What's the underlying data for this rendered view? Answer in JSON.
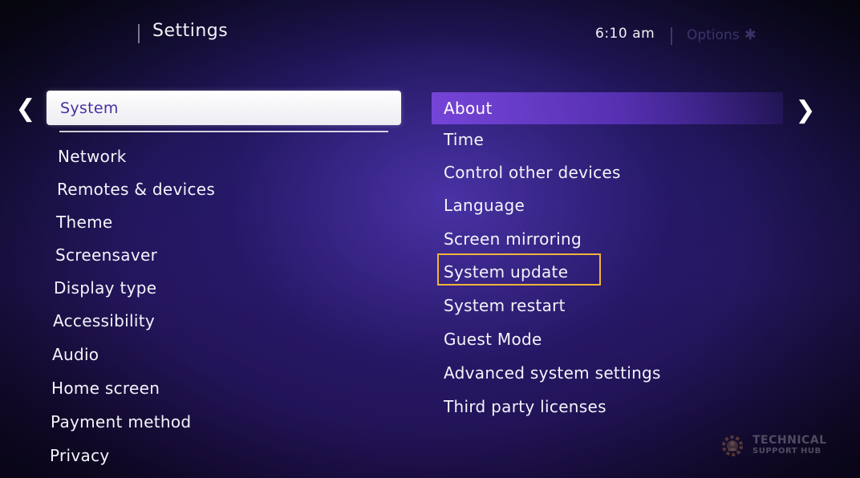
{
  "header": {
    "title": "Settings",
    "time": "6:10",
    "ampm": "am",
    "options_label": "Options",
    "options_icon_glyph": "✱"
  },
  "nav": {
    "left_arrow_glyph": "❮",
    "right_arrow_glyph": "❯"
  },
  "left_menu": {
    "selected": "System",
    "items": [
      "Network",
      "Remotes & devices",
      "Theme",
      "Screensaver",
      "Display type",
      "Accessibility",
      "Audio",
      "Home screen",
      "Payment method",
      "Privacy"
    ]
  },
  "right_menu": {
    "selected": "About",
    "items": [
      "Time",
      "Control other devices",
      "Language",
      "Screen mirroring",
      "System update",
      "System restart",
      "Guest Mode",
      "Advanced system settings",
      "Third party licenses"
    ],
    "highlighted_item": "System update"
  },
  "watermark": {
    "line1": "TECHNICAL",
    "line2": "SUPPORT HUB"
  },
  "colors": {
    "highlight_border": "#f2b43a",
    "selected_text": "#4a2fa0",
    "selected_right_bg": "#7846dc"
  }
}
